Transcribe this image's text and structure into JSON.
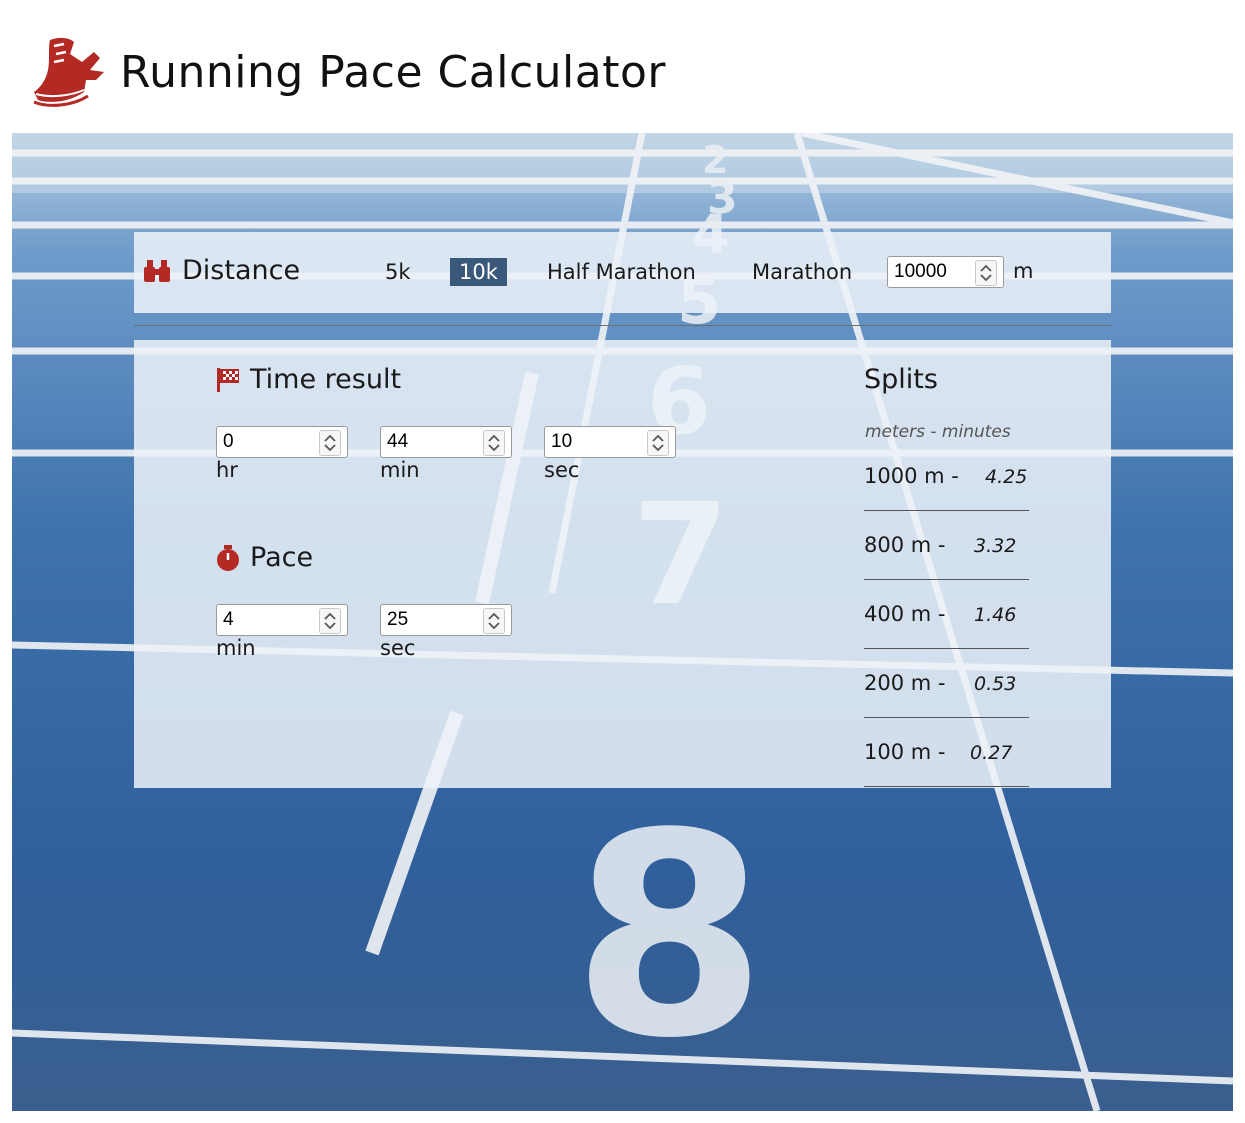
{
  "app": {
    "title": "Running Pace Calculator",
    "logo_icon": "running-shoe-icon",
    "accent_color": "#b32a24"
  },
  "distance": {
    "label": "Distance",
    "icon": "binoculars-icon",
    "options": [
      {
        "label": "5k",
        "active": false
      },
      {
        "label": "10k",
        "active": true
      },
      {
        "label": "Half Marathon",
        "active": false
      },
      {
        "label": "Marathon",
        "active": false
      }
    ],
    "value": "10000",
    "unit": "m",
    "active_color": "#3a5879"
  },
  "time_result": {
    "label": "Time result",
    "icon": "checkered-flag-icon",
    "hr": "0",
    "min": "44",
    "sec": "10",
    "hr_label": "hr",
    "min_label": "min",
    "sec_label": "sec"
  },
  "pace": {
    "label": "Pace",
    "icon": "stopwatch-icon",
    "min": "4",
    "sec": "25",
    "min_label": "min",
    "sec_label": "sec"
  },
  "splits": {
    "title": "Splits",
    "subtitle": "meters - minutes",
    "rows": [
      {
        "distance": "1000 m -",
        "time": "4.25"
      },
      {
        "distance": "800 m -",
        "time": "3.32"
      },
      {
        "distance": "400 m -",
        "time": "1.46"
      },
      {
        "distance": "200 m -",
        "time": "0.53"
      },
      {
        "distance": "100 m -",
        "time": "0.27"
      }
    ]
  }
}
